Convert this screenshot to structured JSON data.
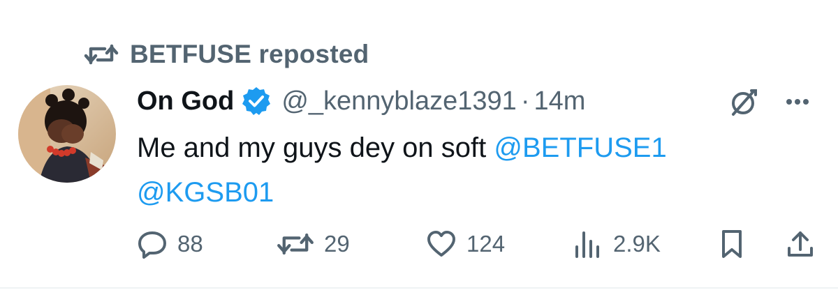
{
  "repost": {
    "icon": "repost-icon",
    "label": "BETFUSE reposted"
  },
  "author": {
    "display_name": "On God",
    "verified_icon": "verified-badge-icon",
    "handle": "@_kennyblaze1391",
    "separator": "·",
    "time": "14m"
  },
  "tweet": {
    "text": "Me and my guys dey on soft",
    "mention_1": "@BETFUSE1",
    "mention_2": "@KGSB01"
  },
  "actions": {
    "reply_count": "88",
    "repost_count": "29",
    "like_count": "124",
    "views_count": "2.9K"
  },
  "colors": {
    "accent": "#1d9bf0",
    "secondary_text": "#536471",
    "primary_text": "#0f1419",
    "divider": "#eff3f4"
  }
}
